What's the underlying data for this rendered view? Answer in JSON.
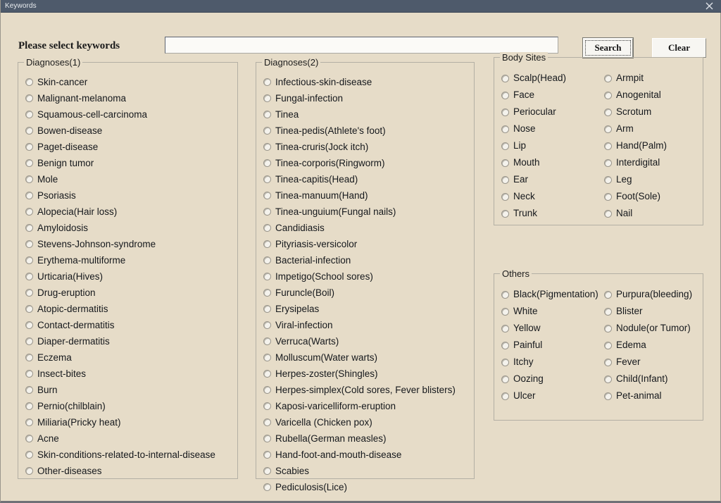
{
  "window": {
    "title": "Keywords",
    "close_icon": "close-icon"
  },
  "search": {
    "label": "Please select keywords",
    "value": "",
    "placeholder": "",
    "search_label": "Search",
    "clear_label": "Clear"
  },
  "colors": {
    "titlebar": "#4e5a6b",
    "background": "#e6dcc8",
    "field": "#fbfaf7",
    "button": "#f7f6f2",
    "groupbox_border": "#b3afa4",
    "text": "#15181c"
  },
  "groups": {
    "diagnoses1": {
      "title": "Diagnoses(1)",
      "items": [
        "Skin-cancer",
        "Malignant-melanoma",
        "Squamous-cell-carcinoma",
        "Bowen-disease",
        "Paget-disease",
        "Benign tumor",
        "Mole",
        "Psoriasis",
        "Alopecia(Hair loss)",
        "Amyloidosis",
        "Stevens-Johnson-syndrome",
        "Erythema-multiforme",
        "Urticaria(Hives)",
        "Drug-eruption",
        "Atopic-dermatitis",
        "Contact-dermatitis",
        "Diaper-dermatitis",
        "Eczema",
        "Insect-bites",
        "Burn",
        "Pernio(chilblain)",
        "Miliaria(Pricky heat)",
        "Acne",
        "Skin-conditions-related-to-internal-disease",
        "Other-diseases"
      ]
    },
    "diagnoses2": {
      "title": "Diagnoses(2)",
      "items": [
        "Infectious-skin-disease",
        "Fungal-infection",
        "Tinea",
        "Tinea-pedis(Athlete's foot)",
        "Tinea-cruris(Jock itch)",
        "Tinea-corporis(Ringworm)",
        "Tinea-capitis(Head)",
        "Tinea-manuum(Hand)",
        "Tinea-unguium(Fungal nails)",
        "Candidiasis",
        "Pityriasis-versicolor",
        "Bacterial-infection",
        "Impetigo(School sores)",
        "Furuncle(Boil)",
        "Erysipelas",
        "Viral-infection",
        "Verruca(Warts)",
        "Molluscum(Water warts)",
        "Herpes-zoster(Shingles)",
        "Herpes-simplex(Cold sores, Fever blisters)",
        "Kaposi-varicelliform-eruption",
        "Varicella (Chicken pox)",
        "Rubella(German measles)",
        "Hand-foot-and-mouth-disease",
        "Scabies",
        "Pediculosis(Lice)"
      ]
    },
    "body_sites": {
      "title": "Body Sites",
      "column1": [
        "Scalp(Head)",
        "Face",
        "Periocular",
        "Nose",
        "Lip",
        "Mouth",
        "Ear",
        "Neck",
        "Trunk"
      ],
      "column2": [
        "Armpit",
        "Anogenital",
        "Scrotum",
        "Arm",
        "Hand(Palm)",
        "Interdigital",
        "Leg",
        "Foot(Sole)",
        "Nail"
      ]
    },
    "others": {
      "title": "Others",
      "column1": [
        "Black(Pigmentation)",
        "White",
        "Yellow",
        "Painful",
        "Itchy",
        "Oozing",
        "Ulcer"
      ],
      "column2": [
        "Purpura(bleeding)",
        "Blister",
        "Nodule(or Tumor)",
        "Edema",
        "Fever",
        "Child(Infant)",
        "Pet-animal"
      ]
    }
  }
}
